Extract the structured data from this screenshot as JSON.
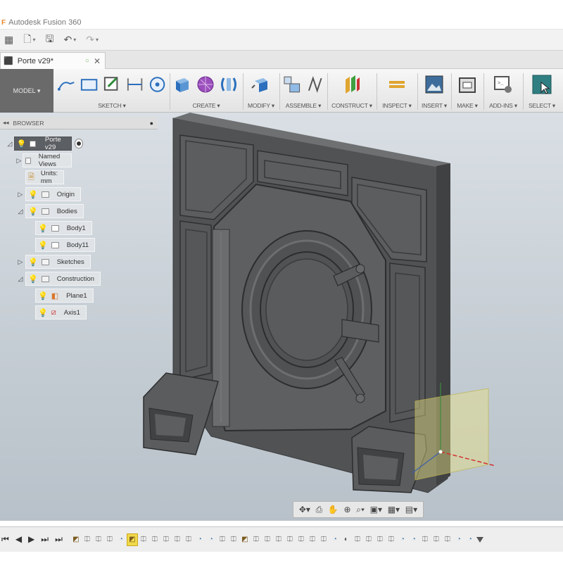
{
  "app": {
    "title": "Autodesk Fusion 360"
  },
  "quick_access": {
    "items": [
      {
        "name": "data-panel",
        "glyph": "▦"
      },
      {
        "name": "file-menu",
        "glyph": "🗋",
        "caret": "▾"
      },
      {
        "name": "save",
        "glyph": "🖫"
      },
      {
        "name": "undo",
        "glyph": "↶",
        "caret": "▾"
      },
      {
        "name": "redo",
        "glyph": "↷",
        "caret": "▾"
      }
    ]
  },
  "document_tab": {
    "label": "Porte v29*",
    "status_glyph": "○",
    "close_glyph": "✕"
  },
  "toolbar": {
    "workspace": "MODEL ▾",
    "groups": {
      "sketch": "SKETCH ▾",
      "create": "CREATE ▾",
      "modify": "MODIFY ▾",
      "assemble": "ASSEMBLE ▾",
      "construct": "CONSTRUCT ▾",
      "inspect": "INSPECT ▾",
      "insert": "INSERT ▾",
      "make": "MAKE ▾",
      "addins": "ADD-INS ▾",
      "select": "SELECT ▾"
    }
  },
  "browser": {
    "header": "BROWSER",
    "collapse_glyph": "◂◂",
    "pin_glyph": "●",
    "root": "Porte v29",
    "items": {
      "named_views": "Named Views",
      "units": "Units: mm",
      "origin": "Origin",
      "bodies": "Bodies",
      "body1": "Body1",
      "body11": "Body11",
      "sketches": "Sketches",
      "construction": "Construction",
      "plane1": "Plane1",
      "axis1": "Axis1"
    }
  },
  "navbar": {
    "items": [
      "✥▾",
      "⎙",
      "✋",
      "⊕",
      "⌕▾",
      "▣▾",
      "▦▾",
      "▤▾"
    ]
  },
  "timeline": {
    "controls": [
      "⏮",
      "◀",
      "▶",
      "⏭",
      "⏭"
    ],
    "items": [
      "sketch",
      "extrude",
      "extrude",
      "extrude",
      "fillet",
      "sketch-active",
      "extrude",
      "extrude",
      "extrude",
      "extrude",
      "extrude",
      "fillet",
      "fillet",
      "extrude",
      "extrude",
      "sketch",
      "extrude",
      "extrude",
      "extrude",
      "extrude",
      "extrude",
      "extrude",
      "extrude",
      "fillet",
      "mirror",
      "extrude",
      "extrude",
      "extrude",
      "extrude",
      "fillet",
      "fillet",
      "extrude",
      "extrude",
      "extrude",
      "fillet",
      "fillet"
    ]
  },
  "colors": {
    "toolbar_bg": "#e8e8e8",
    "viewport_top": "#d9dfe4",
    "model_gray": "#5a5c5e",
    "workspace_bg": "#6a6a6a",
    "select_accent": "#2f7f82"
  }
}
